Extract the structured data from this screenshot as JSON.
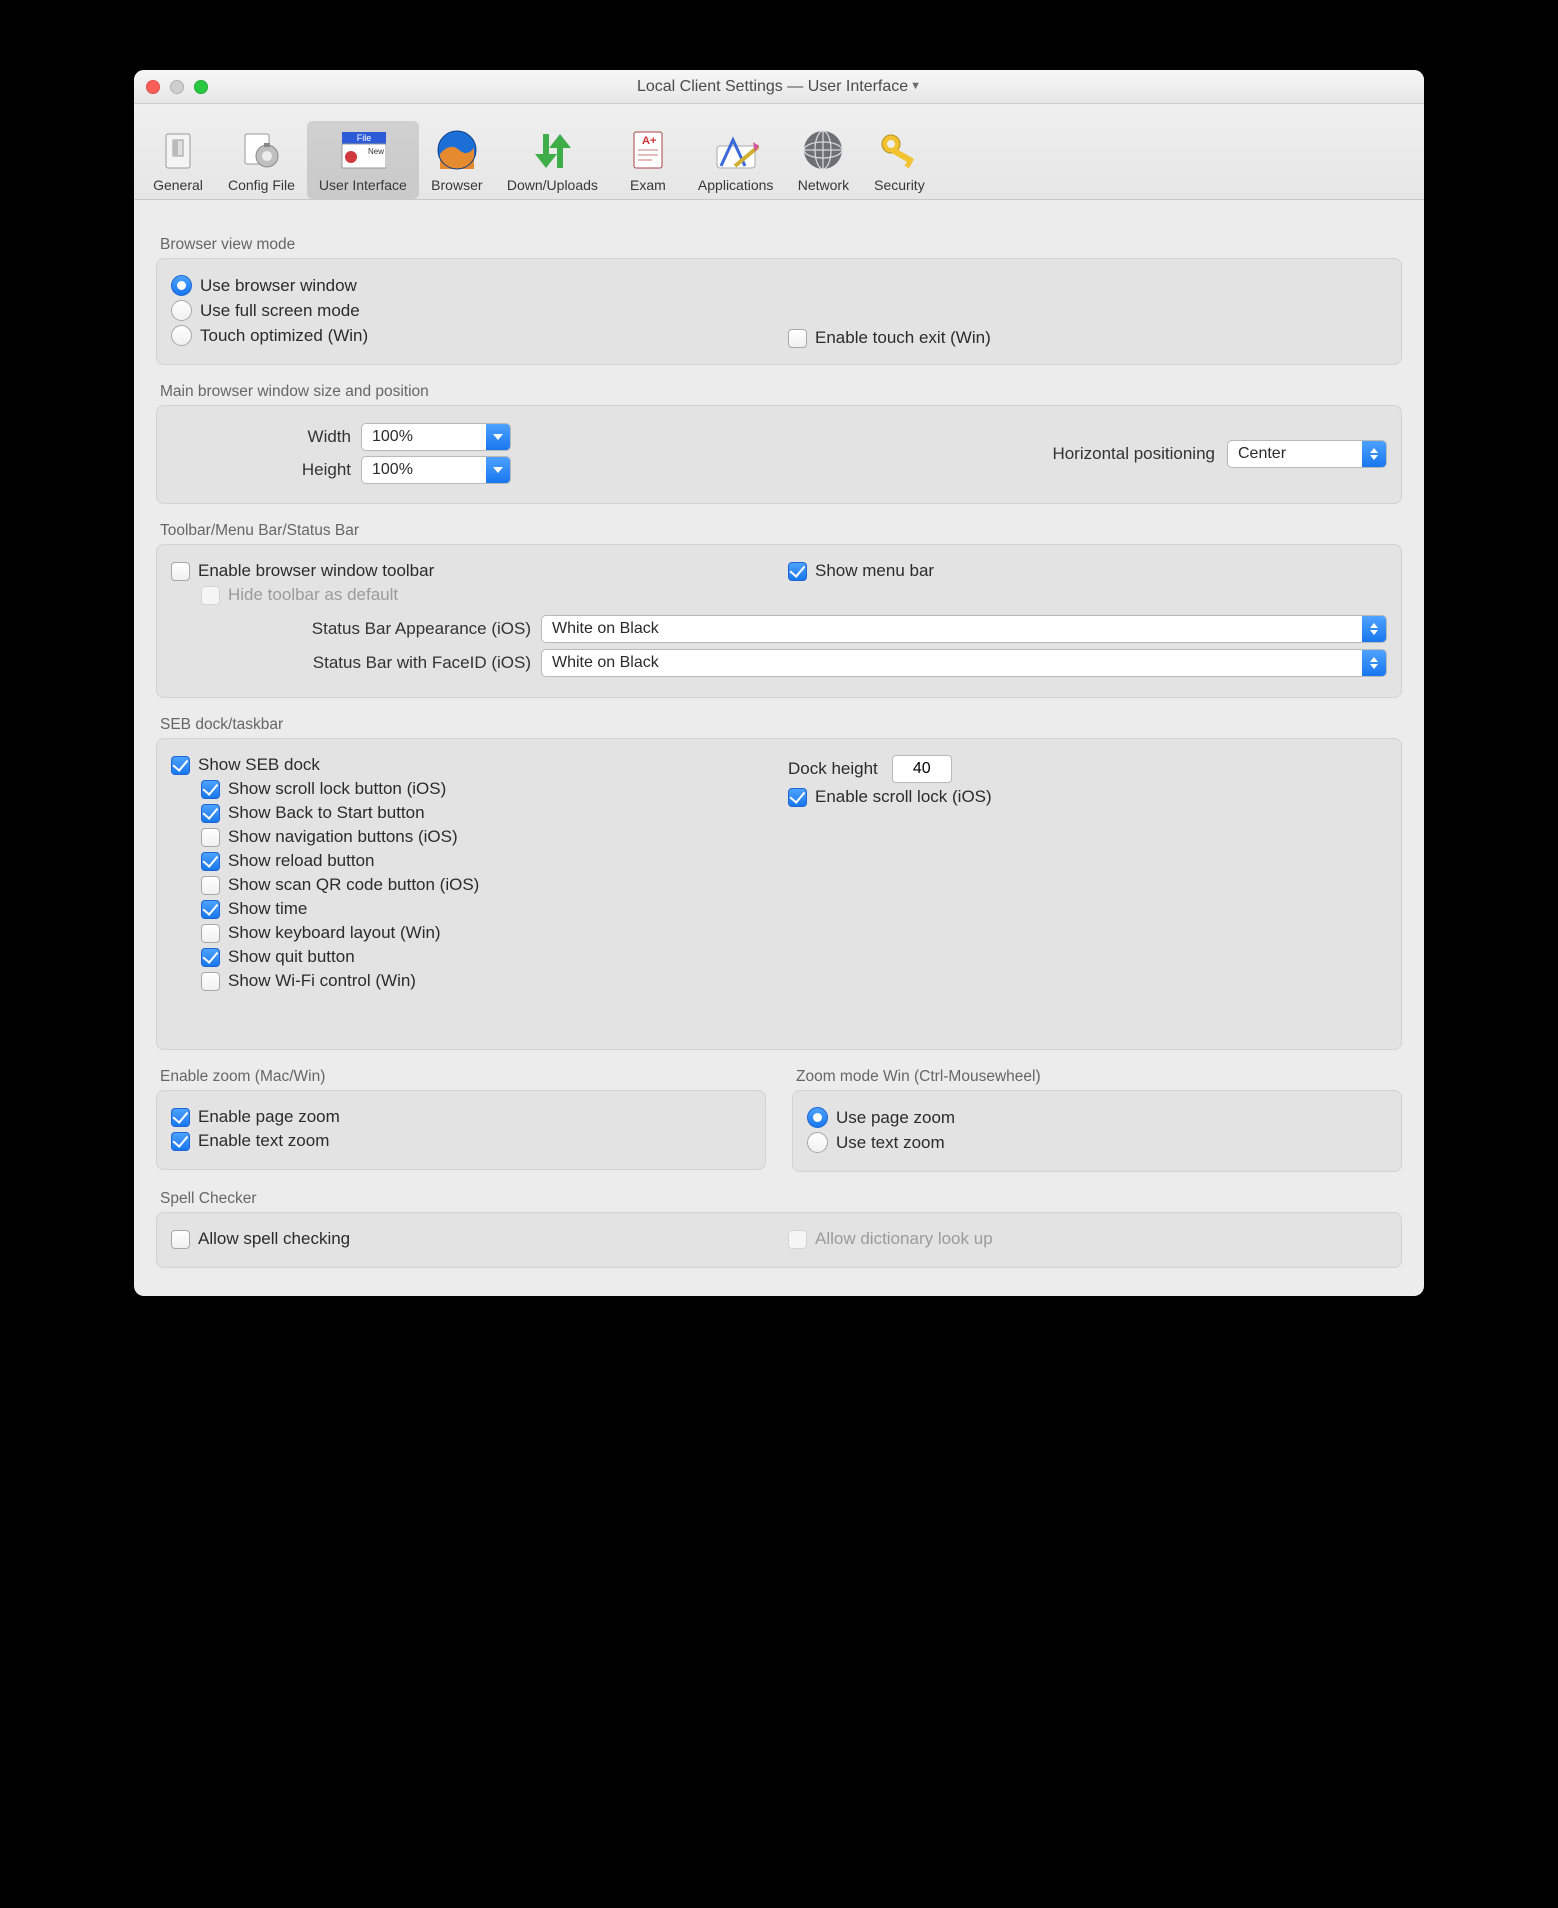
{
  "window_title": "Local Client Settings  —  User Interface",
  "toolbar": [
    {
      "id": "general",
      "label": "General"
    },
    {
      "id": "config-file",
      "label": "Config File"
    },
    {
      "id": "user-interface",
      "label": "User Interface",
      "active": true
    },
    {
      "id": "browser",
      "label": "Browser"
    },
    {
      "id": "down-uploads",
      "label": "Down/Uploads"
    },
    {
      "id": "exam",
      "label": "Exam"
    },
    {
      "id": "applications",
      "label": "Applications"
    },
    {
      "id": "network",
      "label": "Network"
    },
    {
      "id": "security",
      "label": "Security"
    }
  ],
  "sections": {
    "browser_view_mode": {
      "title": "Browser view mode",
      "use_browser_window": "Use browser window",
      "use_full_screen": "Use full screen mode",
      "touch_optimized": "Touch optimized (Win)",
      "enable_touch_exit": "Enable touch exit (Win)",
      "selected": "use_browser_window",
      "enable_touch_exit_checked": false
    },
    "main_window": {
      "title": "Main browser window size and position",
      "width_label": "Width",
      "width_value": "100%",
      "height_label": "Height",
      "height_value": "100%",
      "hpos_label": "Horizontal positioning",
      "hpos_value": "Center"
    },
    "bars": {
      "title": "Toolbar/Menu Bar/Status Bar",
      "enable_toolbar": "Enable browser window toolbar",
      "enable_toolbar_checked": false,
      "hide_toolbar": "Hide toolbar as default",
      "show_menu_bar": "Show menu bar",
      "show_menu_bar_checked": true,
      "status_ios_label": "Status Bar Appearance (iOS)",
      "status_ios_value": "White on Black",
      "status_faceid_label": "Status Bar with FaceID (iOS)",
      "status_faceid_value": "White on Black"
    },
    "dock": {
      "title": "SEB dock/taskbar",
      "show_seb_dock": "Show SEB dock",
      "show_seb_dock_checked": true,
      "items": [
        {
          "label": "Show scroll lock button (iOS)",
          "checked": true
        },
        {
          "label": "Show Back to Start button",
          "checked": true
        },
        {
          "label": "Show navigation buttons (iOS)",
          "checked": false
        },
        {
          "label": "Show reload button",
          "checked": true
        },
        {
          "label": "Show scan QR code button (iOS)",
          "checked": false
        },
        {
          "label": "Show time",
          "checked": true
        },
        {
          "label": "Show keyboard layout (Win)",
          "checked": false
        },
        {
          "label": "Show quit button",
          "checked": true
        },
        {
          "label": "Show Wi-Fi control (Win)",
          "checked": false
        }
      ],
      "dock_height_label": "Dock height",
      "dock_height_value": "40",
      "enable_scroll_lock": "Enable scroll lock (iOS)",
      "enable_scroll_lock_checked": true
    },
    "zoom_enable": {
      "title": "Enable zoom (Mac/Win)",
      "page": "Enable page zoom",
      "page_checked": true,
      "text": "Enable text zoom",
      "text_checked": true
    },
    "zoom_mode": {
      "title": "Zoom mode Win (Ctrl-Mousewheel)",
      "page": "Use page zoom",
      "text": "Use text zoom",
      "selected": "page"
    },
    "spell": {
      "title": "Spell Checker",
      "allow_spell": "Allow spell checking",
      "allow_spell_checked": false,
      "allow_dict": "Allow dictionary look up"
    }
  }
}
